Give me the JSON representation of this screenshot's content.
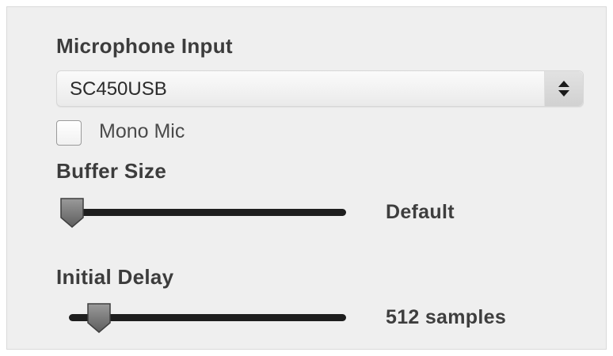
{
  "microphone_input": {
    "label": "Microphone Input",
    "selected_device": "SC450USB"
  },
  "mono_mic": {
    "label": "Mono Mic",
    "checked": false
  },
  "buffer_size": {
    "label": "Buffer Size",
    "value_text": "Default",
    "level": 0.0
  },
  "initial_delay": {
    "label": "Initial Delay",
    "value_text": "512 samples",
    "level": 0.1
  },
  "icons": {
    "select_arrows": "up-down-chevron-icon"
  }
}
